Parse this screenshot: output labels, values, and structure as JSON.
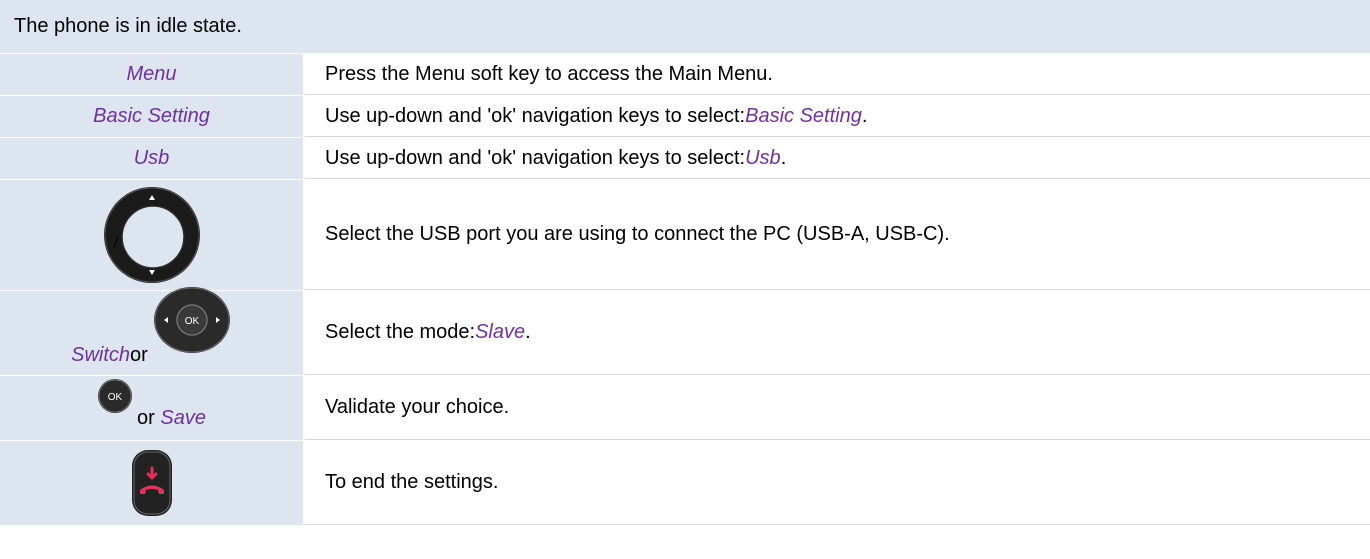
{
  "header": {
    "text": "The phone is in idle state."
  },
  "rows": [
    {
      "left": "Menu",
      "right": "Press the Menu soft key to access the Main Menu."
    },
    {
      "left": "Basic Setting",
      "right_prefix": "Use up-down and 'ok' navigation keys to select: ",
      "right_highlight": "Basic Setting",
      "right_suffix": "."
    },
    {
      "left": "Usb",
      "right_prefix": "Use up-down and 'ok' navigation keys to select: ",
      "right_highlight": "Usb",
      "right_suffix": "."
    },
    {
      "left_icon": "up-down-navigation-key-icon",
      "right": "Select the USB port you are using to connect the PC (USB-A, USB-C)."
    },
    {
      "left": "Switch",
      "left_connector": " or",
      "left_icon": "ok-navigation-key-icon",
      "right_prefix": "Select the mode: ",
      "right_highlight": "Slave",
      "right_suffix": "."
    },
    {
      "left_icon": "ok-key-icon",
      "left_connector": "or ",
      "left": "Save",
      "right": "Validate your choice."
    },
    {
      "left_icon": "end-call-key-icon",
      "right": "To end the settings."
    }
  ],
  "colors": {
    "header_bg": "#dde5f0",
    "highlight": "#7030a0",
    "end_call": "#e8315a"
  }
}
